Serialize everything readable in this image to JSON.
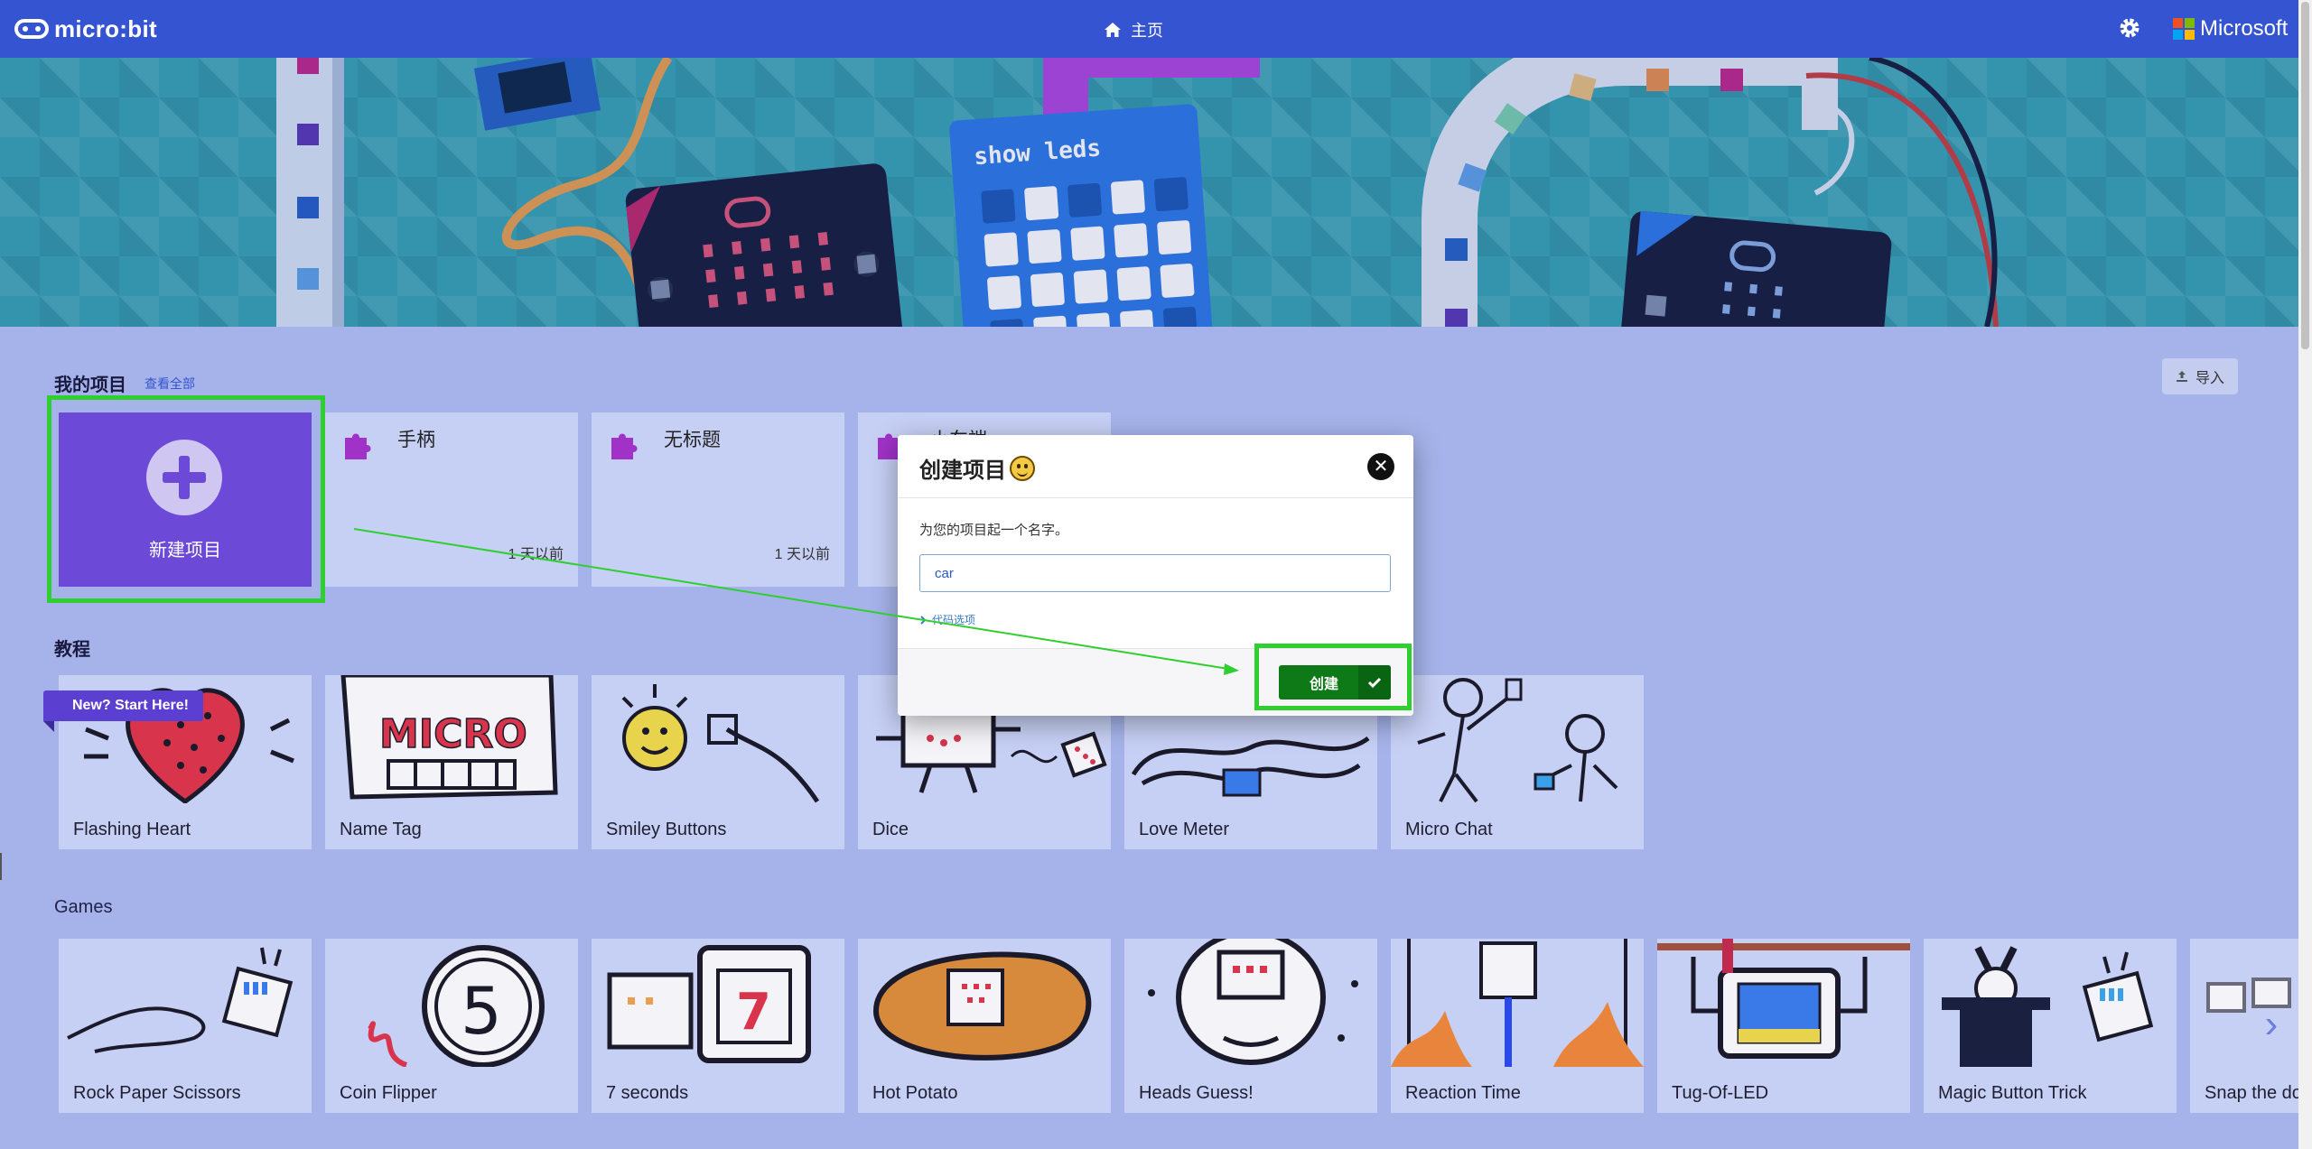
{
  "topbar": {
    "logo_text": "micro:bit",
    "home_label": "主页",
    "microsoft_label": "Microsoft",
    "brand_color": "#3454d1"
  },
  "hero": {
    "show_leds_label": "show leds"
  },
  "my_projects": {
    "title": "我的项目",
    "see_all": "查看全部",
    "import_label": "导入",
    "new_project_label": "新建项目",
    "items": [
      {
        "title": "手柄",
        "time": "1 天以前"
      },
      {
        "title": "无标题",
        "time": "1 天以前"
      },
      {
        "title": "小车端",
        "time": ""
      }
    ]
  },
  "tutorials": {
    "title": "教程",
    "badge": "New? Start Here!",
    "items": [
      {
        "label": "Flashing Heart",
        "icon": "heart-icon"
      },
      {
        "label": "Name Tag",
        "icon": "name-tag-icon"
      },
      {
        "label": "Smiley Buttons",
        "icon": "smiley-buttons-icon"
      },
      {
        "label": "Dice",
        "icon": "dice-icon"
      },
      {
        "label": "Love Meter",
        "icon": "love-meter-icon"
      },
      {
        "label": "Micro Chat",
        "icon": "micro-chat-icon"
      }
    ]
  },
  "games": {
    "title": "Games",
    "items": [
      {
        "label": "Rock Paper Scissors"
      },
      {
        "label": "Coin Flipper"
      },
      {
        "label": "7 seconds"
      },
      {
        "label": "Hot Potato"
      },
      {
        "label": "Heads Guess!"
      },
      {
        "label": "Reaction Time"
      },
      {
        "label": "Tug-Of-LED"
      },
      {
        "label": "Magic Button Trick"
      },
      {
        "label": "Snap the dot"
      }
    ]
  },
  "dialog": {
    "title": "创建项目",
    "prompt": "为您的项目起一个名字。",
    "input_value": "car",
    "advanced_label": "代码选项",
    "create_label": "创建"
  },
  "colors": {
    "overlay": "#a5b3ea",
    "card": "#c6cff4",
    "new_project": "#6c49d6",
    "create_button": "#0e7a17",
    "highlight": "#2fcf2f"
  }
}
